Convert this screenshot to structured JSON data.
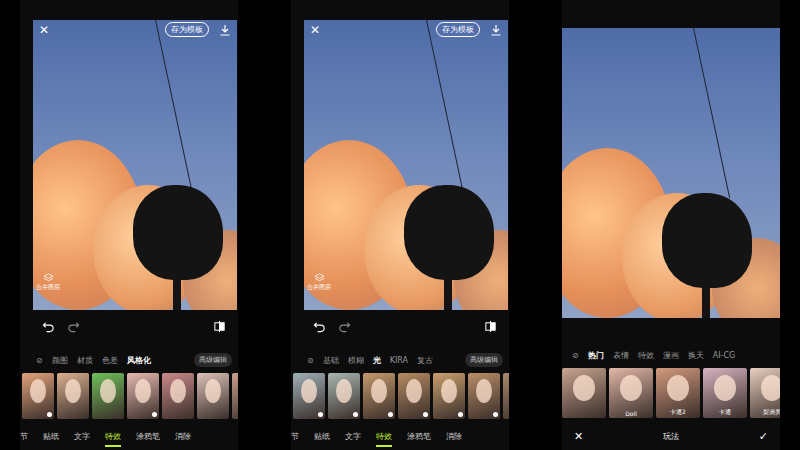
{
  "screens": [
    {
      "kind": "editor",
      "top_bar": {
        "close": "✕",
        "template_button": "存为模板"
      },
      "merge_layers": "合并图层",
      "categories": [
        {
          "label": "⊘",
          "selected": false
        },
        {
          "label": "颜图",
          "selected": false
        },
        {
          "label": "材质",
          "selected": false
        },
        {
          "label": "色差",
          "selected": false
        },
        {
          "label": "风格化",
          "selected": true
        }
      ],
      "advanced": "高级编辑",
      "thumbnails": [
        {
          "label": "",
          "color": "#e0a37a",
          "download": true
        },
        {
          "label": "",
          "color": "#d9b08f",
          "download": false
        },
        {
          "label": "",
          "color": "#6fbf5a",
          "download": false
        },
        {
          "label": "",
          "color": "#e6b9b0",
          "download": true
        },
        {
          "label": "",
          "color": "#c98a8a",
          "download": false
        },
        {
          "label": "",
          "color": "#dcc2b8",
          "download": false
        },
        {
          "label": "",
          "color": "#caa08e",
          "download": false
        }
      ],
      "tabs": [
        {
          "label": "节",
          "selected": false
        },
        {
          "label": "贴纸",
          "selected": false
        },
        {
          "label": "文字",
          "selected": false
        },
        {
          "label": "特效",
          "selected": true
        },
        {
          "label": "涂鸦笔",
          "selected": false
        },
        {
          "label": "消除",
          "selected": false
        }
      ]
    },
    {
      "kind": "editor",
      "top_bar": {
        "close": "✕",
        "template_button": "存为模板"
      },
      "merge_layers": "合并图层",
      "categories": [
        {
          "label": "⊘",
          "selected": false
        },
        {
          "label": "基础",
          "selected": false
        },
        {
          "label": "模糊",
          "selected": false
        },
        {
          "label": "光",
          "selected": true
        },
        {
          "label": "KIRA",
          "selected": false
        },
        {
          "label": "复古",
          "selected": false
        }
      ],
      "advanced": "高级编辑",
      "thumbnails": [
        {
          "label": "",
          "color": "#9fb0b8",
          "download": true
        },
        {
          "label": "",
          "color": "#a8b6b0",
          "download": true
        },
        {
          "label": "",
          "color": "#c49a6c",
          "download": true
        },
        {
          "label": "",
          "color": "#b58a62",
          "download": true
        },
        {
          "label": "",
          "color": "#c9a070",
          "download": true
        },
        {
          "label": "",
          "color": "#b88e66",
          "download": true
        },
        {
          "label": "",
          "color": "#a98a6c",
          "download": true
        }
      ],
      "tabs": [
        {
          "label": "节",
          "selected": false
        },
        {
          "label": "贴纸",
          "selected": false
        },
        {
          "label": "文字",
          "selected": false
        },
        {
          "label": "特效",
          "selected": true
        },
        {
          "label": "涂鸦笔",
          "selected": false
        },
        {
          "label": "消除",
          "selected": false
        }
      ]
    },
    {
      "kind": "play",
      "categories": [
        {
          "label": "⊘",
          "selected": false
        },
        {
          "label": "热门",
          "selected": true
        },
        {
          "label": "表情",
          "selected": false
        },
        {
          "label": "特效",
          "selected": false
        },
        {
          "label": "漫画",
          "selected": false
        },
        {
          "label": "换天",
          "selected": false
        },
        {
          "label": "AI-CG",
          "selected": false
        }
      ],
      "thumbnails": [
        {
          "label": "",
          "color": "#c8a490",
          "download": false
        },
        {
          "label": "Doll",
          "color": "#e2b8a8",
          "download": false
        },
        {
          "label": "卡通2",
          "color": "#d39a7e",
          "download": false
        },
        {
          "label": "卡通",
          "color": "#d7b3c0",
          "download": false
        },
        {
          "label": "梨涡美",
          "color": "#e8cfc0",
          "download": false
        }
      ],
      "bottom_bar": {
        "cancel": "✕",
        "title": "玩法",
        "confirm": "✓"
      }
    }
  ]
}
